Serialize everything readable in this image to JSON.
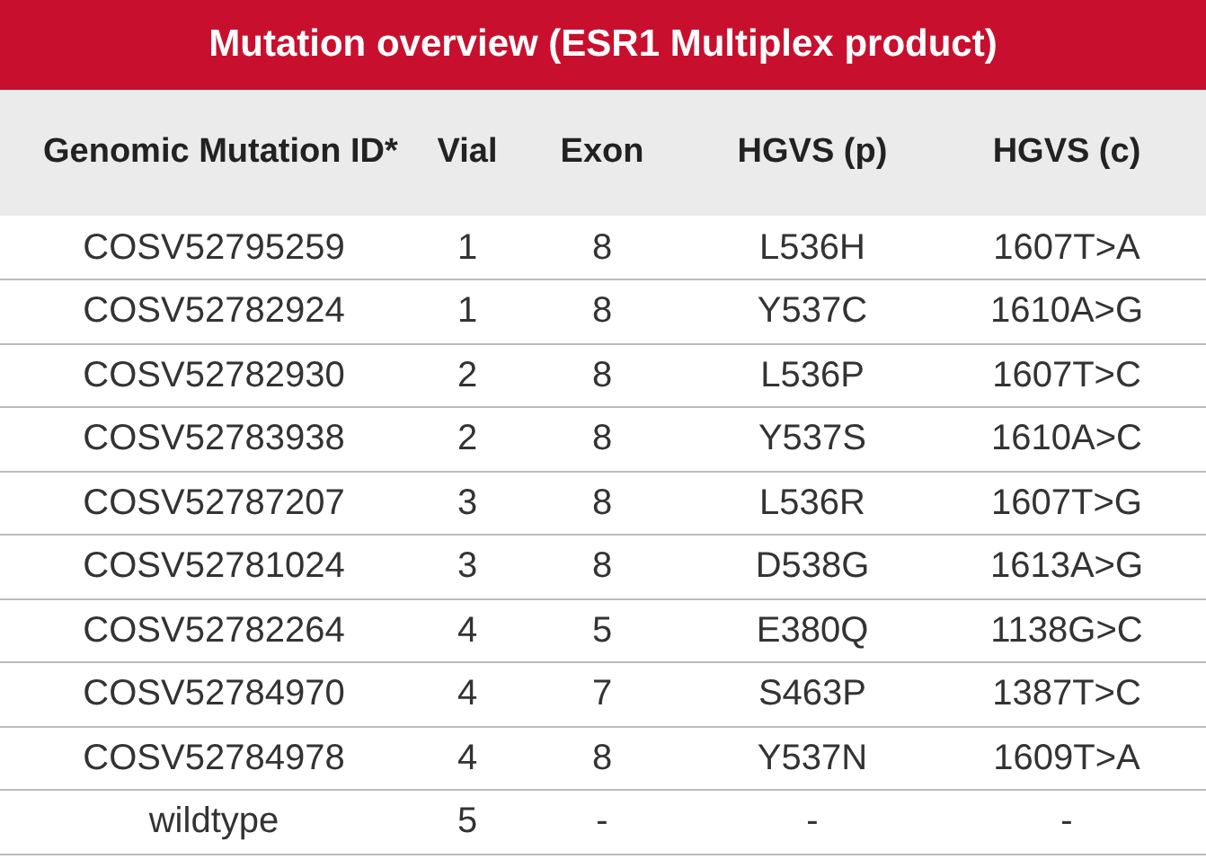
{
  "title": "Mutation overview (ESR1 Multiplex product)",
  "columns": [
    "Genomic Mutation ID*",
    "Vial",
    "Exon",
    "HGVS (p)",
    "HGVS (c)"
  ],
  "rows": [
    [
      "COSV52795259",
      "1",
      "8",
      "L536H",
      "1607T>A"
    ],
    [
      "COSV52782924",
      "1",
      "8",
      "Y537C",
      "1610A>G"
    ],
    [
      "COSV52782930",
      "2",
      "8",
      "L536P",
      "1607T>C"
    ],
    [
      "COSV52783938",
      "2",
      "8",
      "Y537S",
      "1610A>C"
    ],
    [
      "COSV52787207",
      "3",
      "8",
      "L536R",
      "1607T>G"
    ],
    [
      "COSV52781024",
      "3",
      "8",
      "D538G",
      "1613A>G"
    ],
    [
      "COSV52782264",
      "4",
      "5",
      "E380Q",
      "1138G>C"
    ],
    [
      "COSV52784970",
      "4",
      "7",
      "S463P",
      "1387T>C"
    ],
    [
      "COSV52784978",
      "4",
      "8",
      "Y537N",
      "1609T>A"
    ],
    [
      "wildtype",
      "5",
      "-",
      "-",
      "-"
    ]
  ]
}
